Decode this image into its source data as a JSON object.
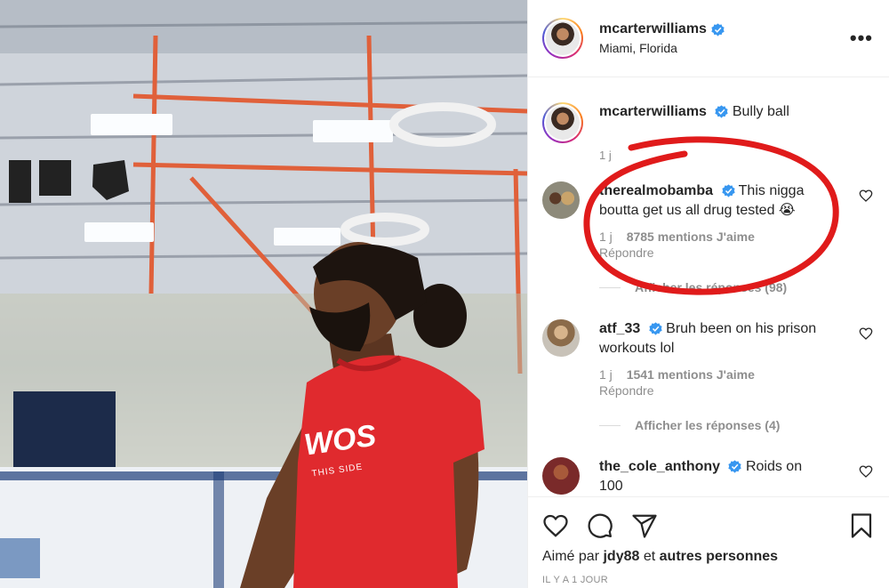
{
  "header": {
    "username": "mcarterwilliams",
    "location": "Miami, Florida"
  },
  "caption": {
    "username": "mcarterwilliams",
    "text": "Bully ball",
    "time": "1 j"
  },
  "comments": [
    {
      "username": "therealmobamba",
      "text": "This nigga boutta get us all drug tested 😭",
      "time": "1 j",
      "likes": "8785 mentions J'aime",
      "reply": "Répondre",
      "view_replies": "Afficher les réponses (98)"
    },
    {
      "username": "atf_33",
      "text": "Bruh been on his prison workouts lol",
      "time": "1 j",
      "likes": "1541 mentions J'aime",
      "reply": "Répondre",
      "view_replies": "Afficher les réponses (4)"
    },
    {
      "username": "the_cole_anthony",
      "text": "Roids on 100"
    }
  ],
  "photo": {
    "shirt_text": "WOS",
    "shirt_subtext": "THIS SIDE"
  },
  "footer": {
    "liked_by_prefix": "Aimé par",
    "liked_by_user": "jdy88",
    "liked_by_middle": "et",
    "liked_by_rest": "autres personnes",
    "time_ago": "IL Y A 1 JOUR"
  },
  "colors": {
    "verified": "#3897f0",
    "annotation": "#e01b1b",
    "shirt": "#e02a2e"
  }
}
